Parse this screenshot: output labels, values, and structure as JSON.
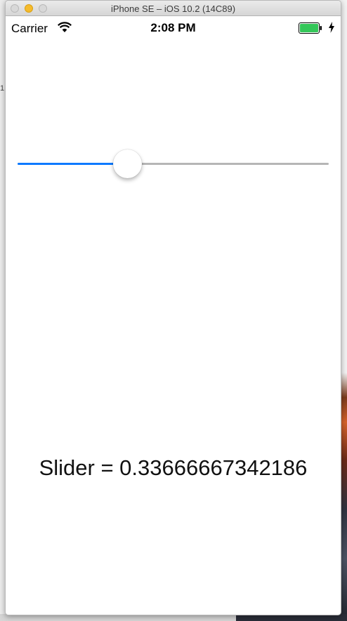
{
  "window": {
    "title": "iPhone SE – iOS 10.2 (14C89)"
  },
  "statusbar": {
    "carrier": "Carrier",
    "time": "2:08 PM",
    "icons": [
      "wifi-icon",
      "battery-icon",
      "charging-icon"
    ],
    "battery_color": "#34c759"
  },
  "slider": {
    "value": 0.3366666734218597,
    "min": 0,
    "max": 1,
    "tint_color": "#0e7aff",
    "track_color": "#b6b6b6"
  },
  "label": {
    "text": "Slider = 0.33666667342186"
  }
}
